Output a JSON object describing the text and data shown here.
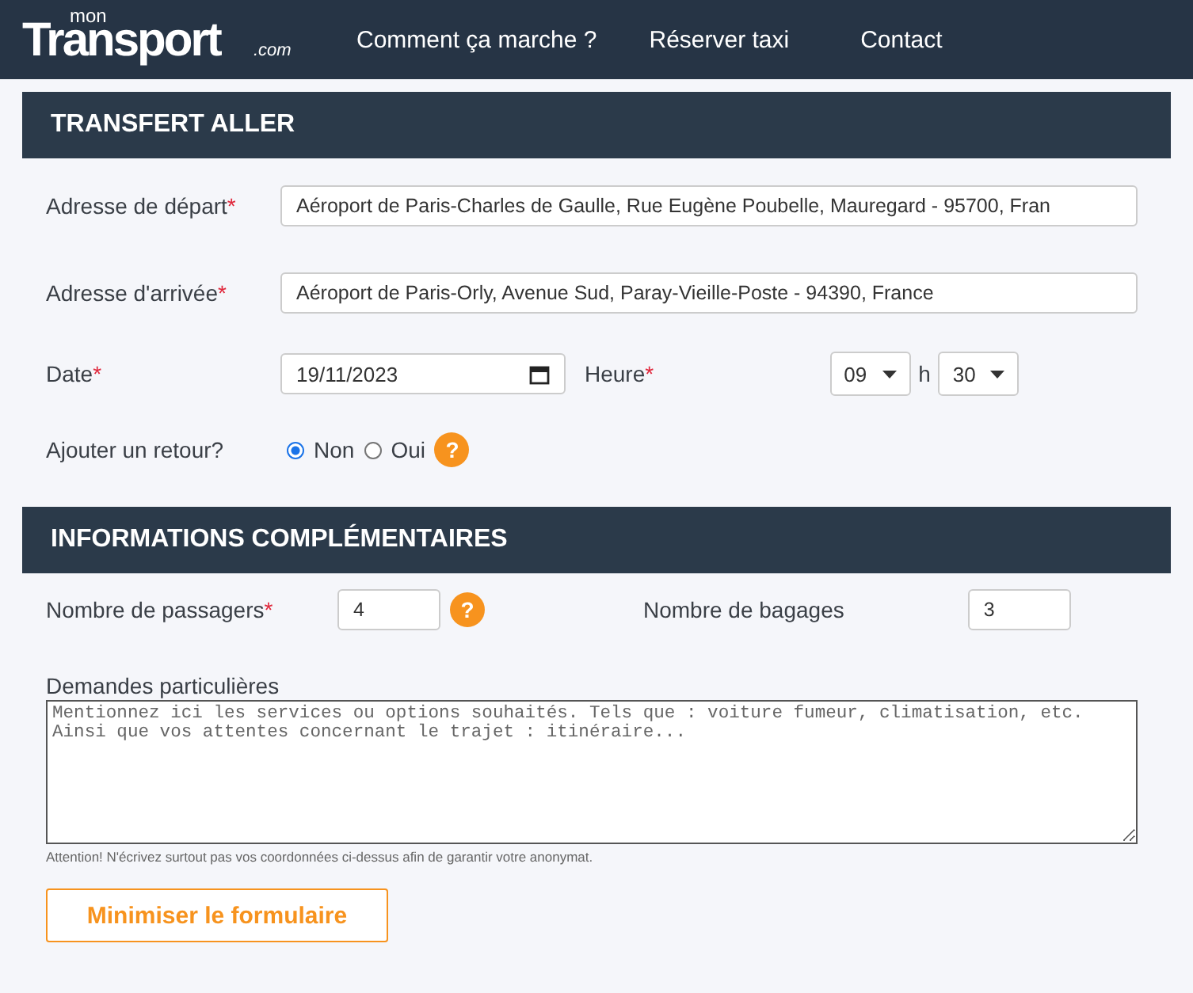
{
  "header": {
    "logo": {
      "top": "mon",
      "main": "Transport",
      "suffix": ".com"
    },
    "nav": [
      {
        "label": "Comment ça marche ?"
      },
      {
        "label": "Réserver taxi"
      },
      {
        "label": "Contact"
      }
    ]
  },
  "outbound": {
    "title": "TRANSFERT ALLER",
    "departure": {
      "label": "Adresse de départ",
      "marker": "*",
      "value": "Aéroport de Paris-Charles de Gaulle, Rue Eugène Poubelle, Mauregard - 95700, Fran"
    },
    "arrival": {
      "label": "Adresse d'arrivée",
      "marker": "*",
      "value": "Aéroport de Paris-Orly, Avenue Sud, Paray-Vieille-Poste - 94390, France"
    },
    "date": {
      "label": "Date",
      "marker": "*",
      "value": "19/11/2023"
    },
    "time": {
      "label": "Heure",
      "marker": "*",
      "hour": "09",
      "separator": "h",
      "minute": "30"
    },
    "return": {
      "label": "Ajouter un retour?",
      "help": "?",
      "options": [
        {
          "label": "Non",
          "selected": true
        },
        {
          "label": "Oui",
          "selected": false
        }
      ]
    }
  },
  "extra": {
    "title": "INFORMATIONS COMPLÉMENTAIRES",
    "passengers": {
      "label": "Nombre de passagers",
      "marker": "*",
      "value": "4",
      "help": "?"
    },
    "luggage": {
      "label": "Nombre de bagages",
      "value": "3"
    },
    "requests": {
      "label": "Demandes particulières",
      "placeholder": "Mentionnez ici les services ou options souhaités. Tels que : voiture fumeur, climatisation, etc.\nAinsi que vos attentes concernant le trajet : itinéraire...",
      "note": "Attention! N'écrivez surtout pas vos coordonnées ci-dessus afin de garantir votre anonymat."
    },
    "minimize_button": "Minimiser le formulaire"
  }
}
